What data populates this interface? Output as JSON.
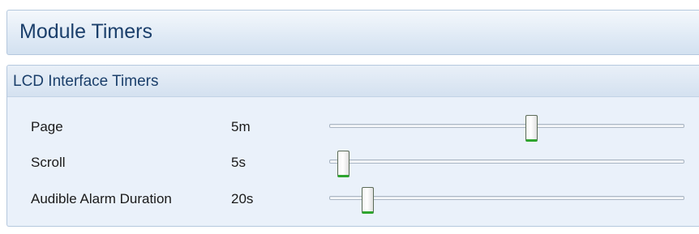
{
  "module": {
    "title": "Module Timers"
  },
  "group": {
    "title": "LCD Interface Timers",
    "rows": [
      {
        "label": "Page",
        "value": "5m",
        "slider_position": 0.57
      },
      {
        "label": "Scroll",
        "value": "5s",
        "slider_position": 0.04
      },
      {
        "label": "Audible Alarm Duration",
        "value": "20s",
        "slider_position": 0.11
      }
    ]
  },
  "colors": {
    "header_text": "#1b3f6b",
    "panel_background": "#eaf1fa",
    "thumb_accent": "#2ea52e"
  }
}
